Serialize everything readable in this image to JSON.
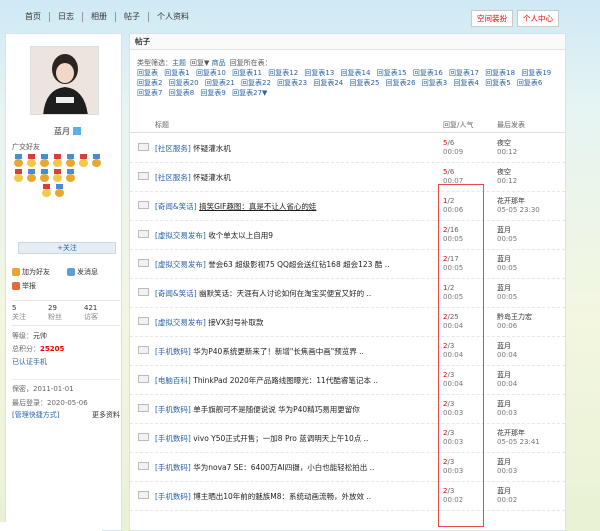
{
  "nav": [
    "首页",
    "日志",
    "相册",
    "帖子",
    "个人资料"
  ],
  "top_buttons": [
    "空间装扮",
    "个人中心"
  ],
  "profile": {
    "name": "蓝月",
    "medals_title": "广交好友",
    "follow_label": "+关注",
    "actions": [
      "加为好友",
      "发消息",
      "举报"
    ],
    "stats": [
      {
        "value": "5",
        "label": "关注"
      },
      {
        "value": "29",
        "label": "粉丝"
      },
      {
        "value": "421",
        "label": "访客"
      }
    ],
    "level_label": "等级：",
    "level_value": "元帅",
    "points_label": "总积分：",
    "points_value": "25205",
    "verify_label": "已认证手机",
    "register": "保密，2011-01-01",
    "last_login": "最后登录：2020-05-06",
    "manage_link": "[管理快捷方式]",
    "more_info": "更多资料"
  },
  "main": {
    "title": "帖子",
    "filter_label": "类型筛选：",
    "filter_items": [
      "主题",
      "回复▼",
      "商品"
    ],
    "section_label": "回复所在表：",
    "tables": [
      "回复表",
      "回复表1",
      "回复表10",
      "回复表11",
      "回复表12",
      "回复表13",
      "回复表14",
      "回复表15",
      "回复表16",
      "回复表17",
      "回复表18",
      "回复表19",
      "回复表2",
      "回复表20",
      "回复表21",
      "回复表22",
      "回复表23",
      "回复表24",
      "回复表25",
      "回复表26",
      "回复表3",
      "回复表4",
      "回复表5",
      "回复表6",
      "回复表7",
      "回复表8",
      "回复表9",
      "回复表27▼"
    ],
    "headers": {
      "title": "标题",
      "reply": "回复/人气",
      "last": "最后发表"
    },
    "rows": [
      {
        "cat": "[社区服务]",
        "title": "怀疑灌水机",
        "u": false,
        "c": "5",
        "v": "/6",
        "t": "00:09",
        "user": "夜空",
        "time": "00:12"
      },
      {
        "cat": "[社区服务]",
        "title": "怀疑灌水机",
        "u": false,
        "c": "5",
        "v": "/6",
        "t": "00:07",
        "user": "夜空",
        "time": "00:12"
      },
      {
        "cat": "[奇闻&笑话]",
        "title": "搞笑GIF趣图：真是不让人省心的娃",
        "u": true,
        "c": "1",
        "v": "/2",
        "t": "00:06",
        "user": "花开那年",
        "time": "05-05 23:30"
      },
      {
        "cat": "[虚拟交易发布]",
        "title": "收个单太以上自用9",
        "u": false,
        "c": "2",
        "v": "/16",
        "t": "00:05",
        "user": "蓝月",
        "time": "00:05"
      },
      {
        "cat": "[虚拟交易发布]",
        "title": "誉会63 超级影视75 QQ超会送红钻168 超会123 酷 ..",
        "u": false,
        "c": "2",
        "v": "/17",
        "t": "00:05",
        "user": "蓝月",
        "time": "00:05"
      },
      {
        "cat": "[奇闻&笑话]",
        "title": "幽默笑话：天涯有人讨论如何在淘宝买便宜又好的 ..",
        "u": false,
        "c": "1",
        "v": "/2",
        "t": "00:05",
        "user": "蓝月",
        "time": "00:05"
      },
      {
        "cat": "[虚拟交易发布]",
        "title": "接VX封号补取款",
        "u": false,
        "c": "2",
        "v": "/25",
        "t": "00:04",
        "user": "黔岛王力宏",
        "time": "00:06"
      },
      {
        "cat": "[手机数码]",
        "title": "华为P40系统更新来了！新增\"长焦画中画\"预览界 ..",
        "u": false,
        "c": "2",
        "v": "/3",
        "t": "00:04",
        "user": "蓝月",
        "time": "00:04"
      },
      {
        "cat": "[电脑百科]",
        "title": "ThinkPad 2020年产品路线图曝光：11代酷睿笔记本 ..",
        "u": false,
        "c": "2",
        "v": "/3",
        "t": "00:04",
        "user": "蓝月",
        "time": "00:04"
      },
      {
        "cat": "[手机数码]",
        "title": "单手旗舰可不是随便说说 华为P40精巧易用更留你",
        "u": false,
        "c": "2",
        "v": "/3",
        "t": "00:03",
        "user": "蓝月",
        "time": "00:03"
      },
      {
        "cat": "[手机数码]",
        "title": "vivo Y50正式开售；一加8 Pro 蓝调明天上午10点 ..",
        "u": false,
        "c": "2",
        "v": "/3",
        "t": "00:03",
        "user": "花开那年",
        "time": "05-05 23:41"
      },
      {
        "cat": "[手机数码]",
        "title": "华为nova7 SE：6400万AI四摄，小白也能轻松拍出 ..",
        "u": false,
        "c": "2",
        "v": "/3",
        "t": "00:03",
        "user": "蓝月",
        "time": "00:03"
      },
      {
        "cat": "[手机数码]",
        "title": "博主晒出10年前的魅族M8：系统动画流畅，外放效 ..",
        "u": false,
        "c": "2",
        "v": "/3",
        "t": "00:02",
        "user": "蓝月",
        "time": "00:02"
      }
    ]
  },
  "colors": {
    "accent": "#e60000",
    "link": "#2a63a8",
    "highlight": "#e84a4a"
  }
}
